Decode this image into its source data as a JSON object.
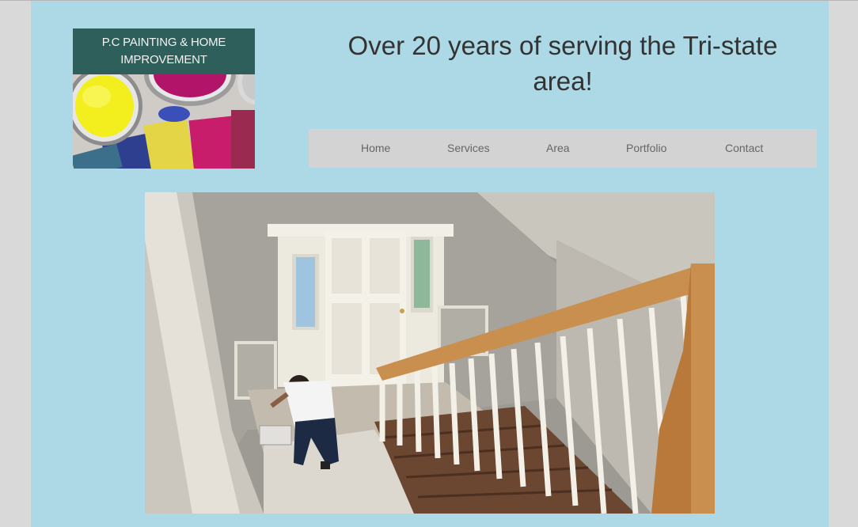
{
  "logo": {
    "line1": "P.C PAINTING & HOME",
    "line2": "IMPROVEMENT",
    "description": "logo-paint-cans-and-swatches-image"
  },
  "header": {
    "tagline": "Over 20 years of serving the Tri-state area!"
  },
  "nav": {
    "items": [
      {
        "label": "Home"
      },
      {
        "label": "Services"
      },
      {
        "label": "Area"
      },
      {
        "label": "Portfolio"
      },
      {
        "label": "Contact"
      }
    ]
  },
  "hero": {
    "image": "photo-painter-on-staircase"
  },
  "colors": {
    "page_bg": "#add8e6",
    "outer_bg": "#d9d9d9",
    "nav_bg": "#d3d3d3",
    "nav_text": "#666666",
    "tagline_text": "#333333",
    "logo_banner": "#2f5f5a"
  }
}
